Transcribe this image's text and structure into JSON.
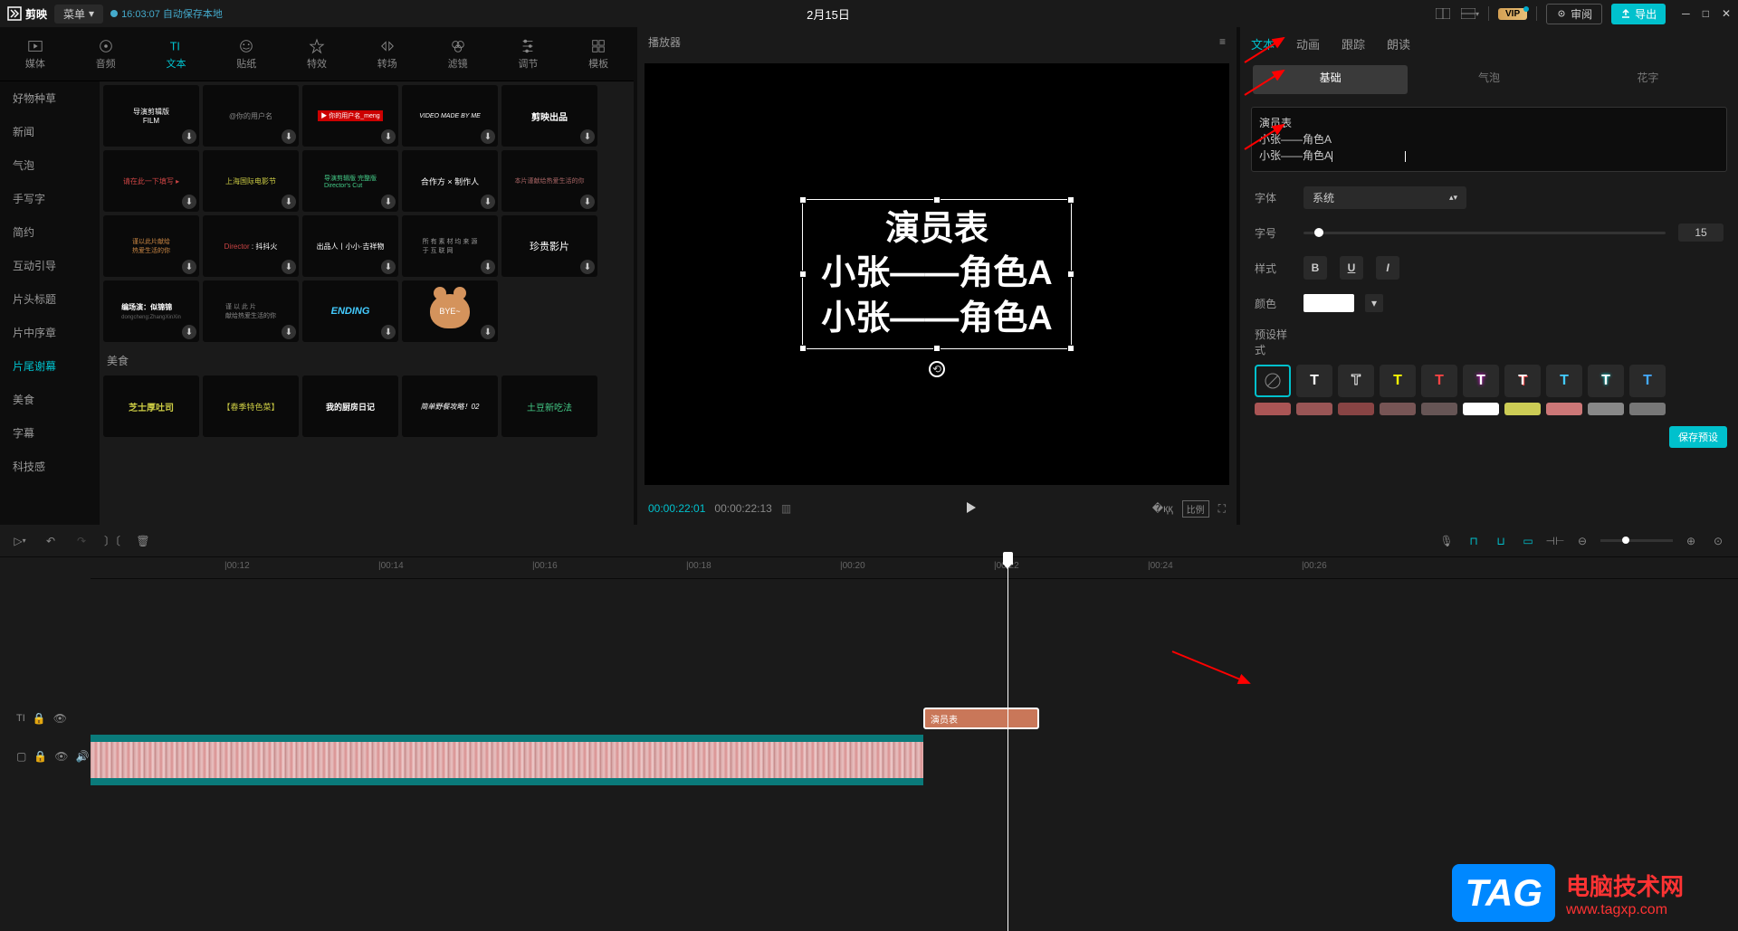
{
  "topBar": {
    "appName": "剪映",
    "menu": "菜单",
    "autosave": "16:03:07 自动保存本地",
    "projectTitle": "2月15日",
    "vip": "VIP",
    "review": "审阅",
    "export": "导出"
  },
  "toolTabs": [
    {
      "label": "媒体"
    },
    {
      "label": "音频"
    },
    {
      "label": "文本"
    },
    {
      "label": "贴纸"
    },
    {
      "label": "特效"
    },
    {
      "label": "转场"
    },
    {
      "label": "滤镜"
    },
    {
      "label": "调节"
    },
    {
      "label": "模板"
    }
  ],
  "sidebar": {
    "items": [
      "好物种草",
      "新闻",
      "气泡",
      "手写字",
      "简约",
      "互动引导",
      "片头标题",
      "片中序章",
      "片尾谢幕",
      "美食",
      "字幕",
      "科技感"
    ],
    "activeIndex": 8
  },
  "sectionLabel": "美食",
  "player": {
    "header": "播放器",
    "textLines": [
      "演员表",
      "小张——角色A",
      "小张——角色A"
    ],
    "currentTime": "00:00:22:01",
    "totalTime": "00:00:22:13"
  },
  "rightPanel": {
    "tabs": [
      "文本",
      "动画",
      "跟踪",
      "朗读"
    ],
    "subTabs": [
      "基础",
      "气泡",
      "花字"
    ],
    "textContent": [
      "演员表",
      "小张——角色A",
      "小张——角色A"
    ],
    "font": {
      "label": "字体",
      "value": "系统"
    },
    "size": {
      "label": "字号",
      "value": "15"
    },
    "style": {
      "label": "样式",
      "bold": "B",
      "underline": "U",
      "italic": "I"
    },
    "color": {
      "label": "颜色"
    },
    "presetLabel": "预设样式",
    "savePreset": "保存预设"
  },
  "ruler": [
    "00:12",
    "00:14",
    "00:16",
    "00:18",
    "00:20",
    "00:22",
    "00:24",
    "00:26"
  ],
  "textClip": "演员表",
  "watermark": {
    "tag": "TAG",
    "text": "电脑技术网",
    "url": "www.tagxp.com"
  }
}
